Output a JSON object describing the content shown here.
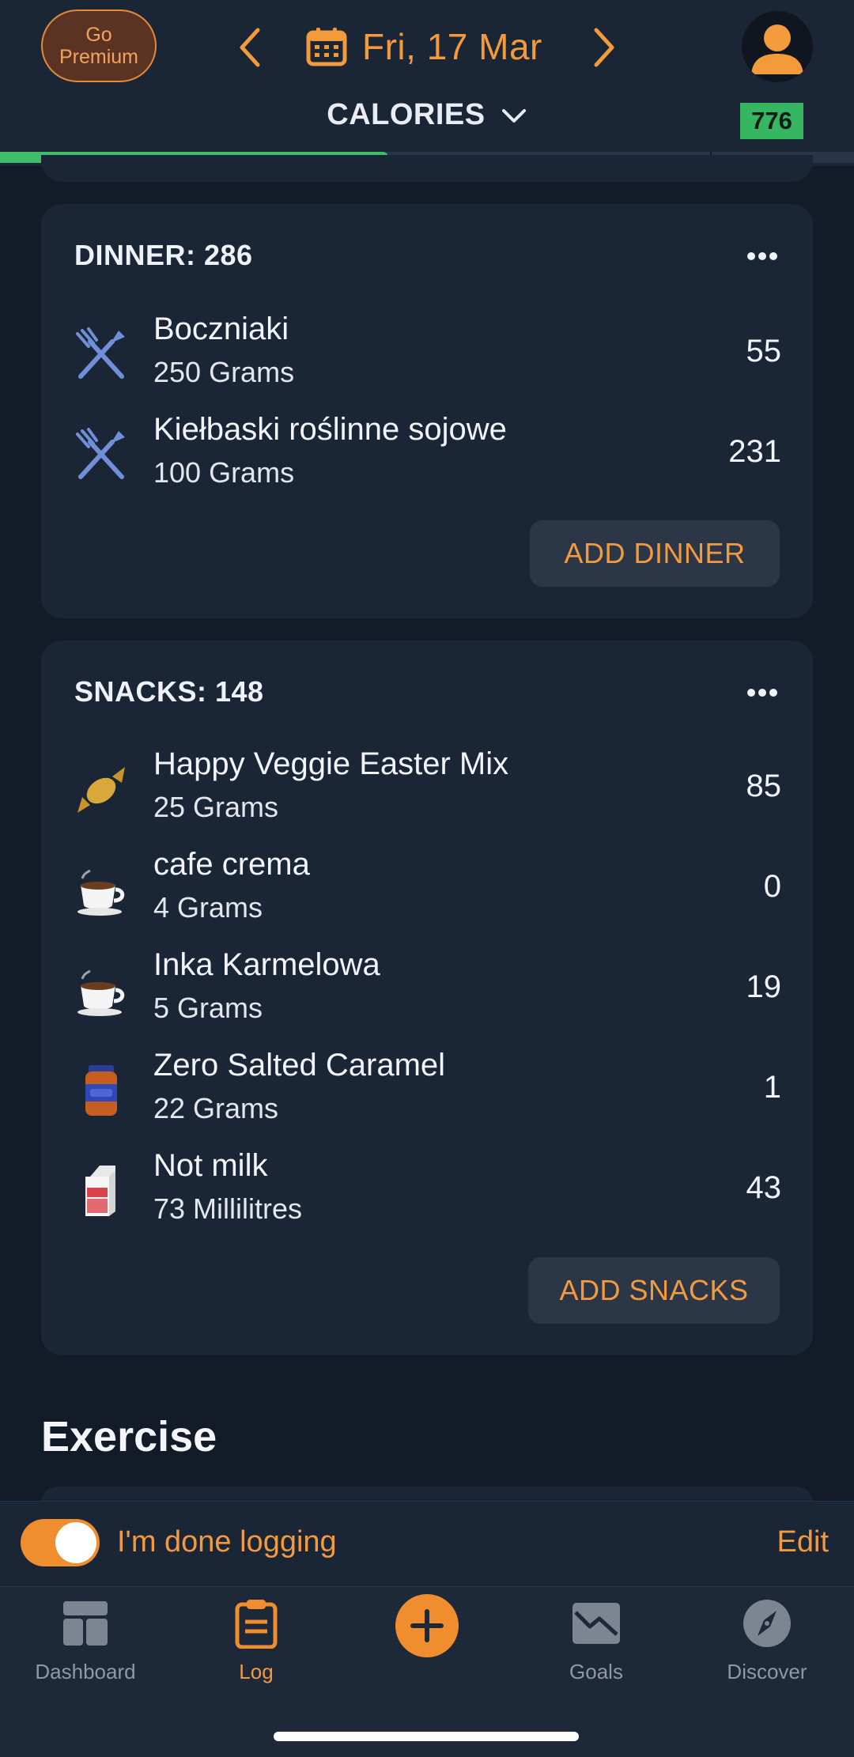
{
  "header": {
    "premium_label": "Go Premium",
    "date": "Fri, 17 Mar",
    "metric_selector": "CALORIES",
    "remaining_badge": "776",
    "progress_fraction": 0.455
  },
  "meals": {
    "dinner": {
      "title": "DINNER: 286",
      "add_label": "ADD DINNER",
      "items": [
        {
          "name": "Boczniaki",
          "qty": "250 Grams",
          "cal": "55",
          "icon": "fork-knife-icon"
        },
        {
          "name": "Kiełbaski roślinne sojowe",
          "qty": "100 Grams",
          "cal": "231",
          "icon": "fork-knife-icon"
        }
      ]
    },
    "snacks": {
      "title": "SNACKS: 148",
      "add_label": "ADD SNACKS",
      "items": [
        {
          "name": "Happy Veggie Easter Mix",
          "qty": "25 Grams",
          "cal": "85",
          "icon": "candy-icon"
        },
        {
          "name": "cafe crema",
          "qty": "4 Grams",
          "cal": "0",
          "icon": "coffee-cup-icon"
        },
        {
          "name": "Inka Karmelowa",
          "qty": "5 Grams",
          "cal": "19",
          "icon": "coffee-cup-icon"
        },
        {
          "name": "Zero Salted Caramel",
          "qty": "22 Grams",
          "cal": "1",
          "icon": "sauce-jar-icon"
        },
        {
          "name": "Not milk",
          "qty": "73 Millilitres",
          "cal": "43",
          "icon": "milk-carton-icon"
        }
      ]
    }
  },
  "exercise": {
    "title": "Exercise"
  },
  "done_logging": {
    "label": "I'm done logging",
    "enabled": true,
    "edit_label": "Edit"
  },
  "tabs": {
    "dashboard": "Dashboard",
    "log": "Log",
    "goals": "Goals",
    "discover": "Discover"
  },
  "colors": {
    "accent": "#f08e2f",
    "progress": "#3fbd6b",
    "card": "#1a2535",
    "background": "#121b27"
  }
}
